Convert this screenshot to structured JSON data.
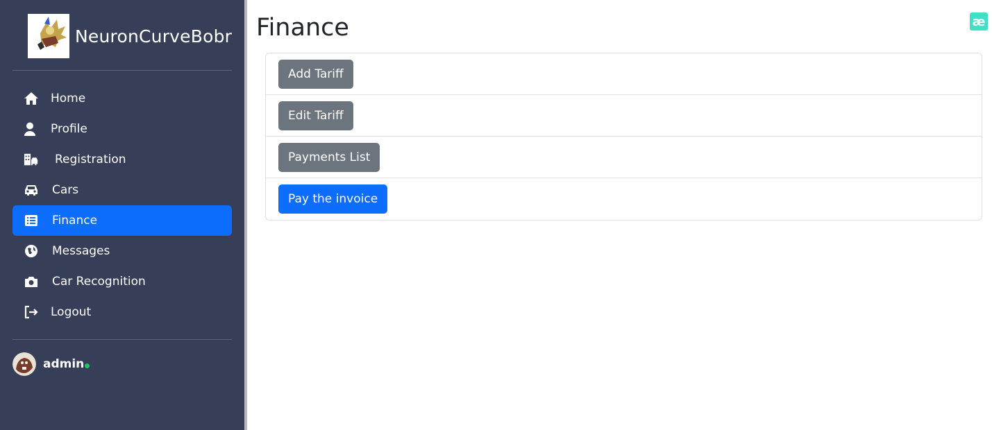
{
  "brand": {
    "title": "NeuronCurveBobr"
  },
  "nav": {
    "items": [
      {
        "label": "Home",
        "icon": "home-icon"
      },
      {
        "label": "Profile",
        "icon": "user-icon"
      },
      {
        "label": "Registration",
        "icon": "building-car-icon"
      },
      {
        "label": "Cars",
        "icon": "car-icon"
      },
      {
        "label": "Finance",
        "icon": "list-icon",
        "active": true
      },
      {
        "label": "Messages",
        "icon": "globe-icon"
      },
      {
        "label": "Car Recognition",
        "icon": "camera-icon"
      },
      {
        "label": "Logout",
        "icon": "logout-icon"
      }
    ]
  },
  "user": {
    "name": "admin",
    "status": "online"
  },
  "page": {
    "title": "Finance",
    "corner_badge": "æ"
  },
  "actions": {
    "add_tariff": "Add Tariff",
    "edit_tariff": "Edit Tariff",
    "payments_list": "Payments List",
    "pay_invoice": "Pay the invoice"
  },
  "colors": {
    "sidebar_bg": "#373f58",
    "accent": "#0d6efd",
    "secondary": "#6c757d",
    "online": "#22c55e",
    "badge": "#3fe0c5"
  }
}
